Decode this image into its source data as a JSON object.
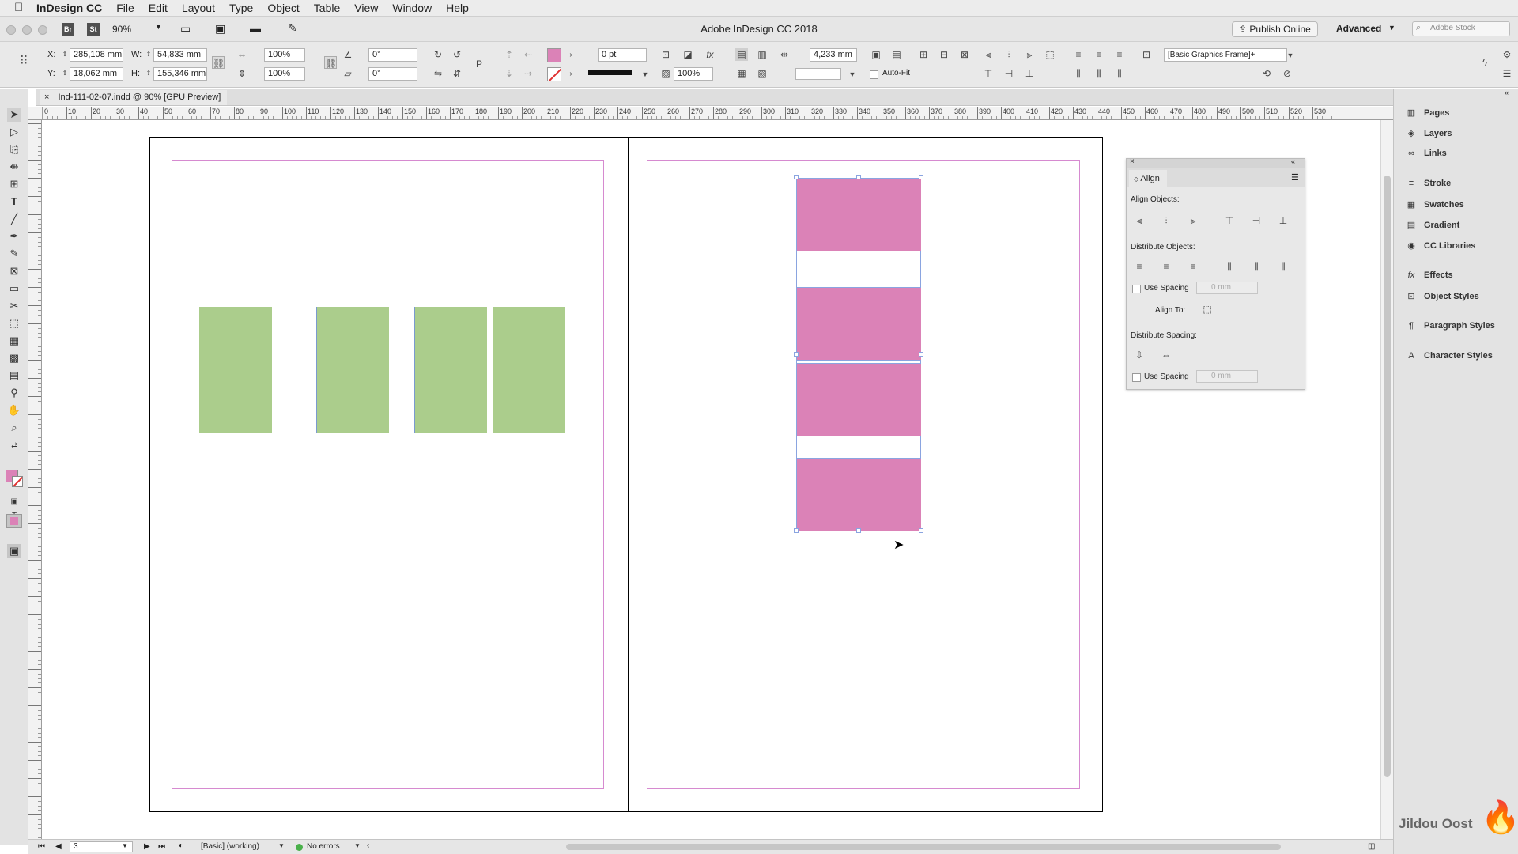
{
  "menu": {
    "app_name": "InDesign CC",
    "items": [
      "File",
      "Edit",
      "Layout",
      "Type",
      "Object",
      "Table",
      "View",
      "Window",
      "Help"
    ]
  },
  "window": {
    "title": "Adobe InDesign CC 2018",
    "zoom": "90%",
    "publish_label": "Publish Online",
    "workspace": "Advanced",
    "search_placeholder": "Adobe Stock",
    "br": "Br",
    "st": "St"
  },
  "control": {
    "x": "285,108 mm",
    "y": "18,062 mm",
    "w": "54,833 mm",
    "h": "155,346 mm",
    "scale_x": "100%",
    "scale_y": "100%",
    "rotate": "0°",
    "shear": "0°",
    "stroke_weight": "0 pt",
    "opacity": "100%",
    "gap": "4,233 mm",
    "object_style": "[Basic Graphics Frame]+",
    "autofit": "Auto-Fit",
    "lbl_x": "X:",
    "lbl_y": "Y:",
    "lbl_w": "W:",
    "lbl_h": "H:"
  },
  "document": {
    "tab_label": "Ind-111-02-07.indd @ 90% [GPU Preview]",
    "close": "×"
  },
  "ruler": {
    "h_ticks": [
      "0",
      "10",
      "20",
      "30",
      "40",
      "50",
      "60",
      "70",
      "80",
      "90",
      "100",
      "110",
      "120",
      "130",
      "140",
      "150",
      "160",
      "170",
      "180",
      "190",
      "200",
      "210",
      "220",
      "230",
      "240",
      "250",
      "260",
      "270",
      "280",
      "290",
      "300",
      "310",
      "320",
      "330",
      "340",
      "350",
      "360",
      "370",
      "380",
      "390",
      "400",
      "410",
      "420",
      "430",
      "440",
      "450",
      "460",
      "470",
      "480",
      "490",
      "500",
      "510",
      "520",
      "530"
    ]
  },
  "status": {
    "page": "3",
    "preflight_profile": "[Basic] (working)",
    "errors": "No errors"
  },
  "panels": {
    "items": [
      {
        "name": "Pages",
        "icon": "pages-icon"
      },
      {
        "name": "Layers",
        "icon": "layers-icon"
      },
      {
        "name": "Links",
        "icon": "links-icon"
      },
      {
        "name": "Stroke",
        "icon": "stroke-icon"
      },
      {
        "name": "Swatches",
        "icon": "swatches-icon"
      },
      {
        "name": "Gradient",
        "icon": "gradient-icon"
      },
      {
        "name": "CC Libraries",
        "icon": "cc-libraries-icon"
      },
      {
        "name": "Effects",
        "icon": "effects-icon"
      },
      {
        "name": "Object Styles",
        "icon": "object-styles-icon"
      },
      {
        "name": "Paragraph Styles",
        "icon": "paragraph-styles-icon"
      },
      {
        "name": "Character Styles",
        "icon": "character-styles-icon"
      }
    ]
  },
  "align_panel": {
    "title": "Align",
    "align_objects": "Align Objects:",
    "distribute_objects": "Distribute Objects:",
    "use_spacing": "Use Spacing",
    "spacing_value": "0 mm",
    "align_to": "Align To:",
    "distribute_spacing": "Distribute Spacing:",
    "use_spacing2": "Use Spacing",
    "spacing_value2": "0 mm"
  },
  "watermark": {
    "text": "Jildou Oost"
  },
  "colors": {
    "green_frame": "#abcd8c",
    "pink_frame": "#db82b7",
    "margin_guide": "#d68ad0"
  }
}
